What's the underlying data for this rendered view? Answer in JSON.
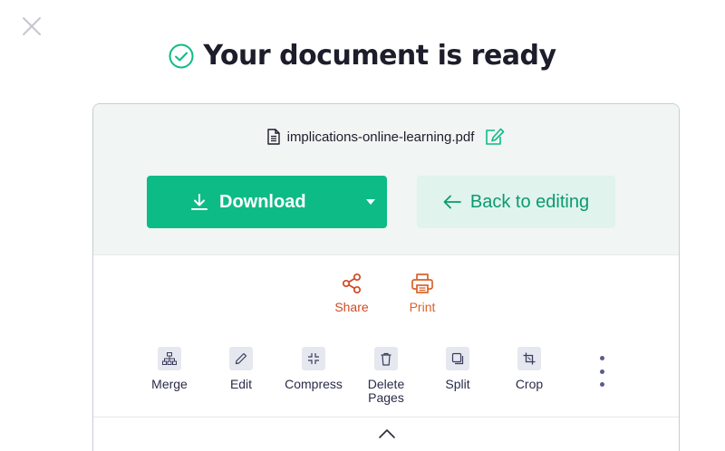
{
  "dialog": {
    "title": "Your document is ready"
  },
  "file": {
    "name": "implications-online-learning.pdf"
  },
  "buttons": {
    "download_label": "Download",
    "back_label": "Back to editing"
  },
  "actions": [
    {
      "label": "Share",
      "icon": "share-icon",
      "color": "#cf4a24"
    },
    {
      "label": "Print",
      "icon": "printer-icon",
      "color": "#d9622b"
    }
  ],
  "tools": [
    {
      "label": "Merge",
      "icon": "sitemap-icon"
    },
    {
      "label": "Edit",
      "icon": "pencil-icon"
    },
    {
      "label": "Compress",
      "icon": "compress-icon"
    },
    {
      "label": "Delete\nPages",
      "icon": "trash-icon"
    },
    {
      "label": "Split",
      "icon": "copy-icon"
    },
    {
      "label": "Crop",
      "icon": "crop-icon"
    }
  ],
  "colors": {
    "accent": "#0dbb86",
    "accent_light": "#e0f3ec",
    "card_top_bg": "#f1f5f3",
    "text_dark": "#1d1d2b"
  }
}
